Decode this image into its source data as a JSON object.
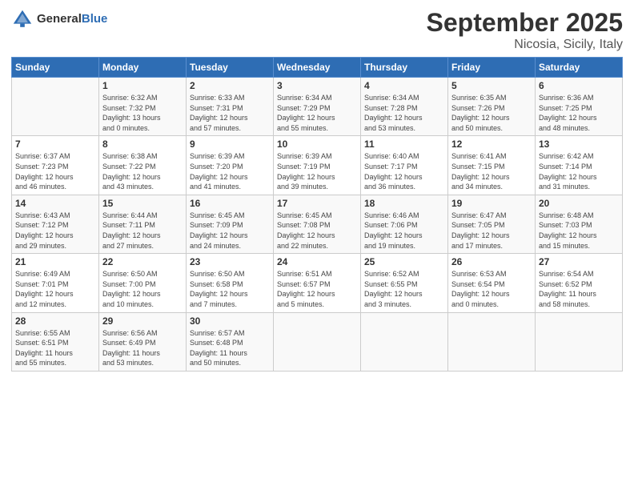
{
  "header": {
    "logo_general": "General",
    "logo_blue": "Blue",
    "month": "September 2025",
    "location": "Nicosia, Sicily, Italy"
  },
  "days_of_week": [
    "Sunday",
    "Monday",
    "Tuesday",
    "Wednesday",
    "Thursday",
    "Friday",
    "Saturday"
  ],
  "weeks": [
    [
      {
        "day": "",
        "info": ""
      },
      {
        "day": "1",
        "info": "Sunrise: 6:32 AM\nSunset: 7:32 PM\nDaylight: 13 hours\nand 0 minutes."
      },
      {
        "day": "2",
        "info": "Sunrise: 6:33 AM\nSunset: 7:31 PM\nDaylight: 12 hours\nand 57 minutes."
      },
      {
        "day": "3",
        "info": "Sunrise: 6:34 AM\nSunset: 7:29 PM\nDaylight: 12 hours\nand 55 minutes."
      },
      {
        "day": "4",
        "info": "Sunrise: 6:34 AM\nSunset: 7:28 PM\nDaylight: 12 hours\nand 53 minutes."
      },
      {
        "day": "5",
        "info": "Sunrise: 6:35 AM\nSunset: 7:26 PM\nDaylight: 12 hours\nand 50 minutes."
      },
      {
        "day": "6",
        "info": "Sunrise: 6:36 AM\nSunset: 7:25 PM\nDaylight: 12 hours\nand 48 minutes."
      }
    ],
    [
      {
        "day": "7",
        "info": "Sunrise: 6:37 AM\nSunset: 7:23 PM\nDaylight: 12 hours\nand 46 minutes."
      },
      {
        "day": "8",
        "info": "Sunrise: 6:38 AM\nSunset: 7:22 PM\nDaylight: 12 hours\nand 43 minutes."
      },
      {
        "day": "9",
        "info": "Sunrise: 6:39 AM\nSunset: 7:20 PM\nDaylight: 12 hours\nand 41 minutes."
      },
      {
        "day": "10",
        "info": "Sunrise: 6:39 AM\nSunset: 7:19 PM\nDaylight: 12 hours\nand 39 minutes."
      },
      {
        "day": "11",
        "info": "Sunrise: 6:40 AM\nSunset: 7:17 PM\nDaylight: 12 hours\nand 36 minutes."
      },
      {
        "day": "12",
        "info": "Sunrise: 6:41 AM\nSunset: 7:15 PM\nDaylight: 12 hours\nand 34 minutes."
      },
      {
        "day": "13",
        "info": "Sunrise: 6:42 AM\nSunset: 7:14 PM\nDaylight: 12 hours\nand 31 minutes."
      }
    ],
    [
      {
        "day": "14",
        "info": "Sunrise: 6:43 AM\nSunset: 7:12 PM\nDaylight: 12 hours\nand 29 minutes."
      },
      {
        "day": "15",
        "info": "Sunrise: 6:44 AM\nSunset: 7:11 PM\nDaylight: 12 hours\nand 27 minutes."
      },
      {
        "day": "16",
        "info": "Sunrise: 6:45 AM\nSunset: 7:09 PM\nDaylight: 12 hours\nand 24 minutes."
      },
      {
        "day": "17",
        "info": "Sunrise: 6:45 AM\nSunset: 7:08 PM\nDaylight: 12 hours\nand 22 minutes."
      },
      {
        "day": "18",
        "info": "Sunrise: 6:46 AM\nSunset: 7:06 PM\nDaylight: 12 hours\nand 19 minutes."
      },
      {
        "day": "19",
        "info": "Sunrise: 6:47 AM\nSunset: 7:05 PM\nDaylight: 12 hours\nand 17 minutes."
      },
      {
        "day": "20",
        "info": "Sunrise: 6:48 AM\nSunset: 7:03 PM\nDaylight: 12 hours\nand 15 minutes."
      }
    ],
    [
      {
        "day": "21",
        "info": "Sunrise: 6:49 AM\nSunset: 7:01 PM\nDaylight: 12 hours\nand 12 minutes."
      },
      {
        "day": "22",
        "info": "Sunrise: 6:50 AM\nSunset: 7:00 PM\nDaylight: 12 hours\nand 10 minutes."
      },
      {
        "day": "23",
        "info": "Sunrise: 6:50 AM\nSunset: 6:58 PM\nDaylight: 12 hours\nand 7 minutes."
      },
      {
        "day": "24",
        "info": "Sunrise: 6:51 AM\nSunset: 6:57 PM\nDaylight: 12 hours\nand 5 minutes."
      },
      {
        "day": "25",
        "info": "Sunrise: 6:52 AM\nSunset: 6:55 PM\nDaylight: 12 hours\nand 3 minutes."
      },
      {
        "day": "26",
        "info": "Sunrise: 6:53 AM\nSunset: 6:54 PM\nDaylight: 12 hours\nand 0 minutes."
      },
      {
        "day": "27",
        "info": "Sunrise: 6:54 AM\nSunset: 6:52 PM\nDaylight: 11 hours\nand 58 minutes."
      }
    ],
    [
      {
        "day": "28",
        "info": "Sunrise: 6:55 AM\nSunset: 6:51 PM\nDaylight: 11 hours\nand 55 minutes."
      },
      {
        "day": "29",
        "info": "Sunrise: 6:56 AM\nSunset: 6:49 PM\nDaylight: 11 hours\nand 53 minutes."
      },
      {
        "day": "30",
        "info": "Sunrise: 6:57 AM\nSunset: 6:48 PM\nDaylight: 11 hours\nand 50 minutes."
      },
      {
        "day": "",
        "info": ""
      },
      {
        "day": "",
        "info": ""
      },
      {
        "day": "",
        "info": ""
      },
      {
        "day": "",
        "info": ""
      }
    ]
  ]
}
